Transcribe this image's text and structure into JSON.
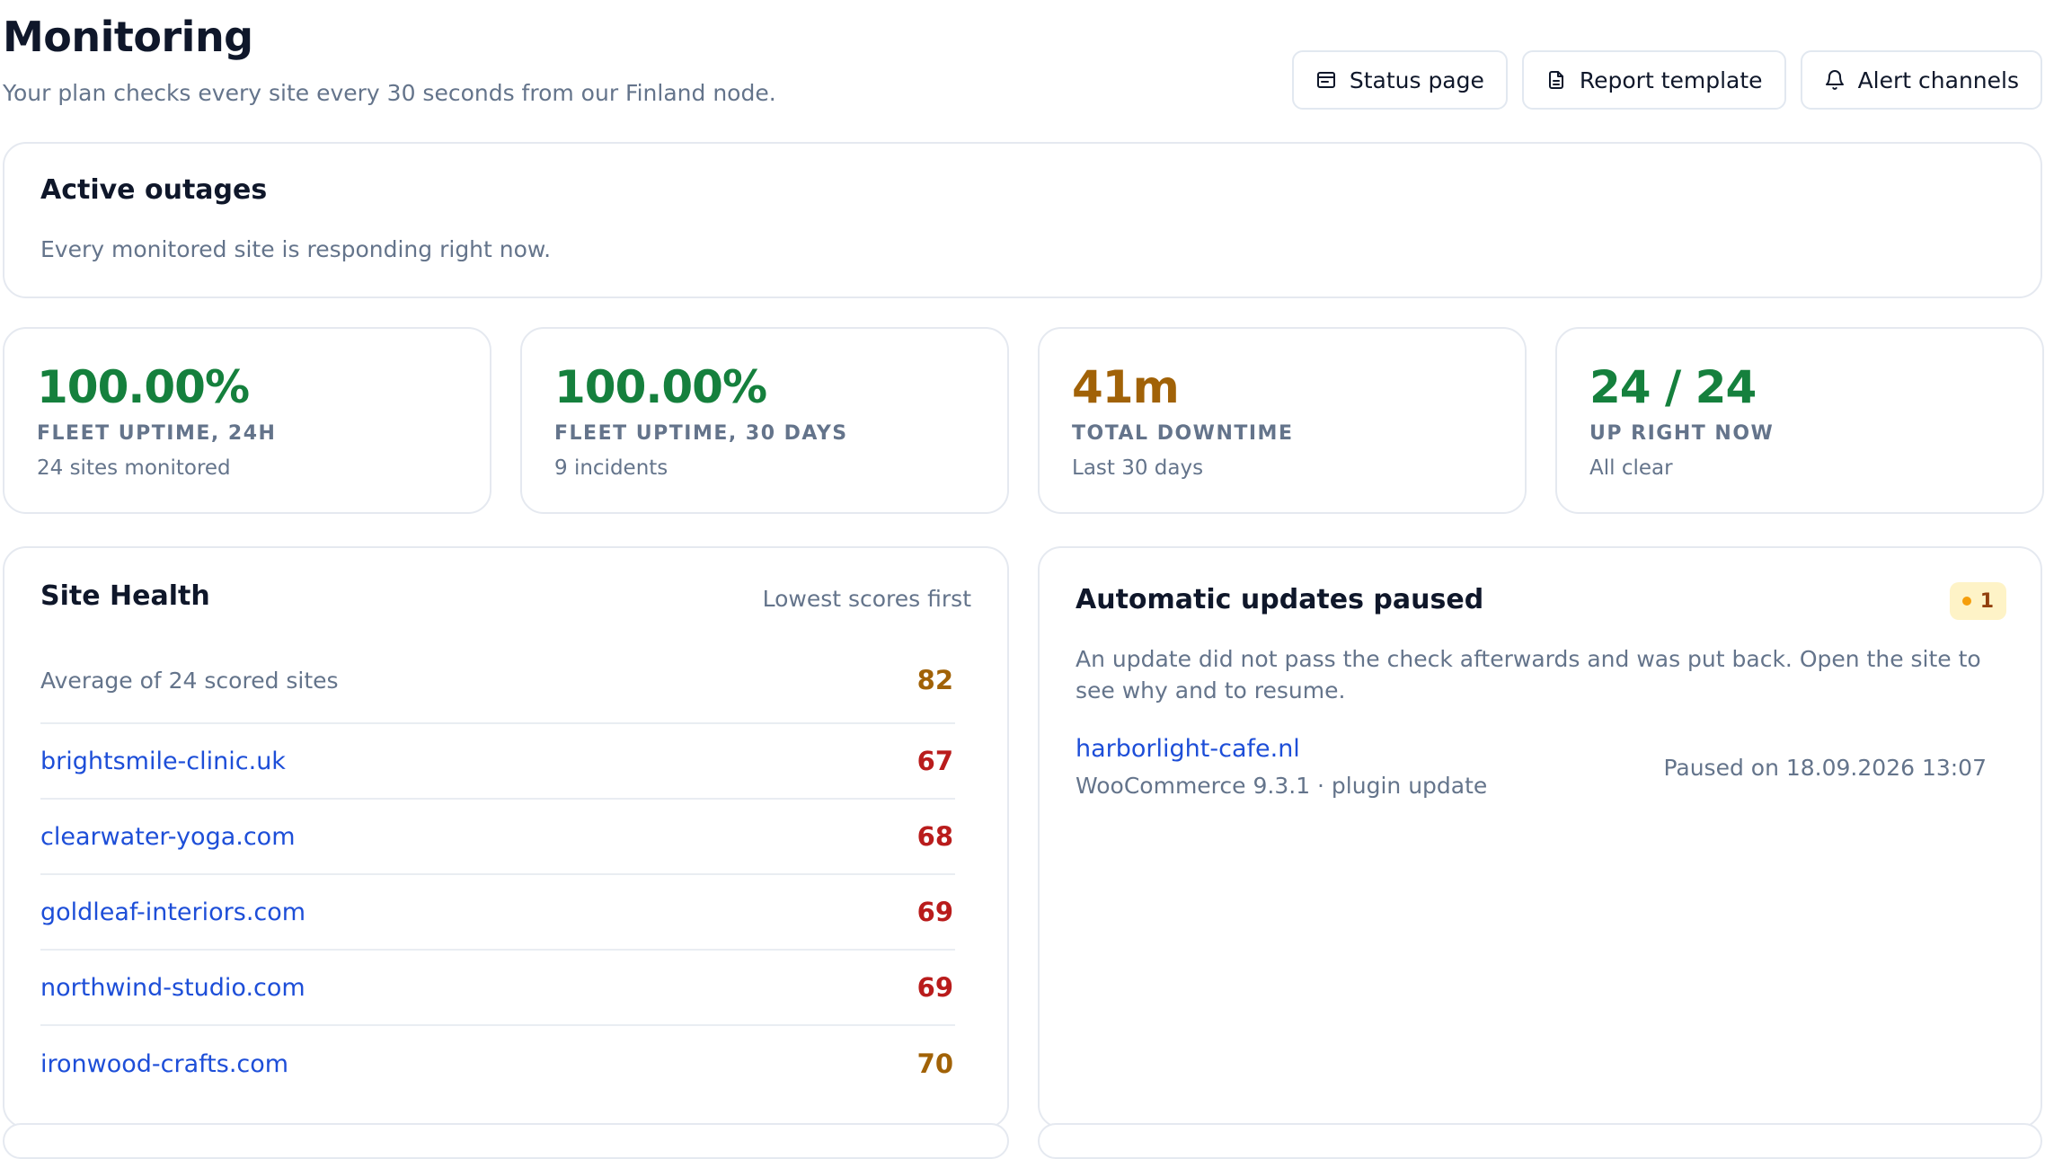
{
  "header": {
    "title": "Monitoring",
    "subtitle": "Your plan checks every site every 30 seconds from our Finland node.",
    "actions": [
      {
        "label": "Status page",
        "icon": "window-icon"
      },
      {
        "label": "Report template",
        "icon": "document-icon"
      },
      {
        "label": "Alert channels",
        "icon": "bell-icon"
      }
    ]
  },
  "outages": {
    "title": "Active outages",
    "message": "Every monitored site is responding right now."
  },
  "stats": [
    {
      "value": "100.00%",
      "label": "FLEET UPTIME, 24H",
      "note": "24 sites monitored",
      "color": "#15803d"
    },
    {
      "value": "100.00%",
      "label": "FLEET UPTIME, 30 DAYS",
      "note": "9 incidents",
      "color": "#15803d"
    },
    {
      "value": "41m",
      "label": "TOTAL DOWNTIME",
      "note": "Last 30 days",
      "color": "#a16207"
    },
    {
      "value": "24 / 24",
      "label": "UP RIGHT NOW",
      "note": "All clear",
      "color": "#15803d"
    }
  ],
  "health": {
    "title": "Site Health",
    "sort_label": "Lowest scores first",
    "average": {
      "label": "Average of 24 scored sites",
      "score": "82",
      "color": "#a16207"
    },
    "sites": [
      {
        "name": "brightsmile-clinic.uk",
        "score": "67",
        "color": "#b91c1c"
      },
      {
        "name": "clearwater-yoga.com",
        "score": "68",
        "color": "#b91c1c"
      },
      {
        "name": "goldleaf-interiors.com",
        "score": "69",
        "color": "#b91c1c"
      },
      {
        "name": "northwind-studio.com",
        "score": "69",
        "color": "#b91c1c"
      },
      {
        "name": "ironwood-crafts.com",
        "score": "70",
        "color": "#a16207"
      }
    ]
  },
  "updates": {
    "title": "Automatic updates paused",
    "badge_count": "1",
    "description": "An update did not pass the check afterwards and was put back. Open the site to see why and to resume.",
    "item": {
      "site": "harborlight-cafe.nl",
      "detail": "WooCommerce 9.3.1 · plugin update",
      "paused": "Paused on 18.09.2026 13:07"
    }
  }
}
